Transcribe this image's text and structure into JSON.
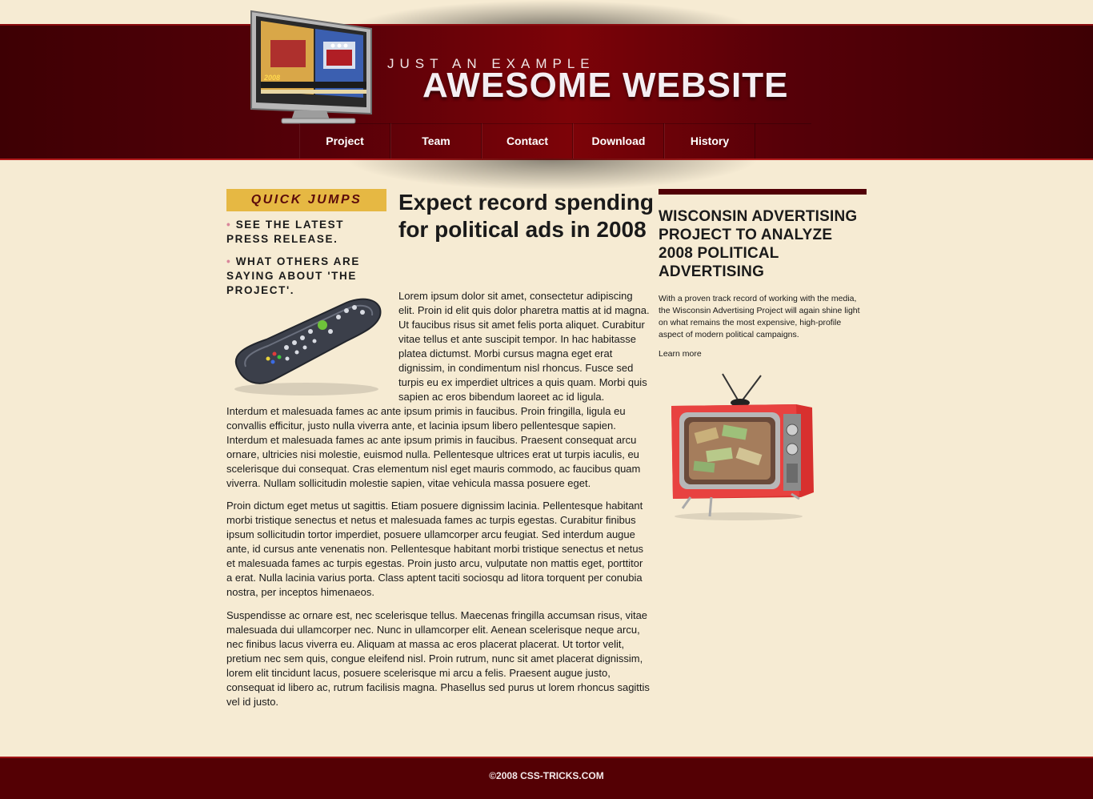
{
  "header": {
    "tagline": "JUST AN EXAMPLE",
    "site_title": "AWESOME WEBSITE",
    "logo_caption": "2008",
    "nav": [
      "Project",
      "Team",
      "Contact",
      "Download",
      "History"
    ]
  },
  "sidebar": {
    "heading": "QUICK JUMPS",
    "links": [
      "SEE THE LATEST PRESS RELEASE.",
      "WHAT OTHERS ARE SAYING ABOUT 'THE PROJECT'."
    ]
  },
  "article": {
    "title": "Expect record spending for political ads in 2008",
    "paragraph1_wrap": "Lorem ipsum dolor sit amet, consectetur adipiscing elit. Proin id elit quis dolor pharetra mattis at id magna. Ut faucibus risus sit amet felis porta aliquet. Curabitur vitae tellus et ante suscipit tempor. In hac habitasse platea dictumst. Morbi cursus magna eget erat dignissim, in condimentum nisl rhoncus. Fusce sed turpis eu ex imperdiet ultrices a quis quam. Morbi quis sapien ac eros bibendum laoreet ac id ligula.",
    "paragraph1_rest": "Interdum et malesuada fames ac ante ipsum primis in faucibus. Proin fringilla, ligula eu convallis efficitur, justo nulla viverra ante, et lacinia ipsum libero pellentesque sapien. Interdum et malesuada fames ac ante ipsum primis in faucibus. Praesent consequat arcu ornare, ultricies nisi molestie, euismod nulla. Pellentesque ultrices erat ut turpis iaculis, eu scelerisque dui consequat. Cras elementum nisl eget mauris commodo, ac faucibus quam viverra. Nullam sollicitudin molestie sapien, vitae vehicula massa posuere eget.",
    "paragraph2": "Proin dictum eget metus ut sagittis. Etiam posuere dignissim lacinia. Pellentesque habitant morbi tristique senectus et netus et malesuada fames ac turpis egestas. Curabitur finibus ipsum sollicitudin tortor imperdiet, posuere ullamcorper arcu feugiat. Sed interdum augue ante, id cursus ante venenatis non. Pellentesque habitant morbi tristique senectus et netus et malesuada fames ac turpis egestas. Proin justo arcu, vulputate non mattis eget, porttitor a erat. Nulla lacinia varius porta. Class aptent taciti sociosqu ad litora torquent per conubia nostra, per inceptos himenaeos.",
    "paragraph3": "Suspendisse ac ornare est, nec scelerisque tellus. Maecenas fringilla accumsan risus, vitae malesuada dui ullamcorper nec. Nunc in ullamcorper elit. Aenean scelerisque neque arcu, nec finibus lacus viverra eu. Aliquam at massa ac eros placerat placerat. Ut tortor velit, pretium nec sem quis, congue eleifend nisl. Proin rutrum, nunc sit amet placerat dignissim, lorem elit tincidunt lacus, posuere scelerisque mi arcu a felis. Praesent augue justo, consequat id libero ac, rutrum facilisis magna. Phasellus sed purus ut lorem rhoncus sagittis vel id justo."
  },
  "aside": {
    "title": "WISCONSIN ADVERTISING PROJECT TO ANALYZE 2008 POLITICAL ADVERTISING",
    "text": "With a proven track record of working with the media, the Wisconsin Advertising Project will again shine light on what remains the most expensive, high-profile aspect of modern political campaigns.",
    "link": "Learn more"
  },
  "footer": {
    "text": "©2008 CSS-TRICKS.COM"
  },
  "colors": {
    "background": "#f6ebd3",
    "header_dark": "#3e0004",
    "header_mid": "#7d0308",
    "quick_jumps_bg": "#e6b843",
    "aside_bar": "#520006",
    "footer": "#540004"
  }
}
